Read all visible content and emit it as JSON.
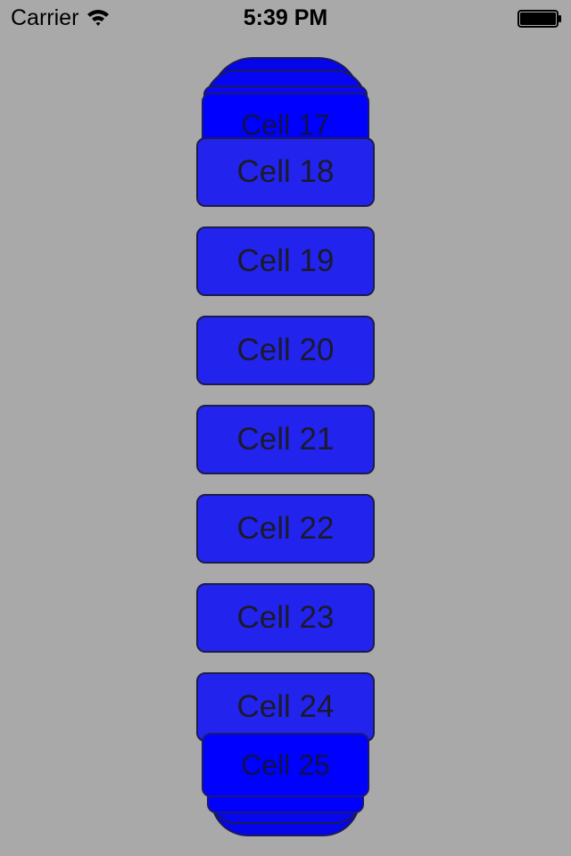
{
  "status_bar": {
    "carrier": "Carrier",
    "time": "5:39 PM",
    "wifi_icon": "wifi-icon",
    "battery_icon": "battery-icon"
  },
  "cells": [
    {
      "label": "Cell 17"
    },
    {
      "label": "Cell 18"
    },
    {
      "label": "Cell 19"
    },
    {
      "label": "Cell 20"
    },
    {
      "label": "Cell 21"
    },
    {
      "label": "Cell 22"
    },
    {
      "label": "Cell 23"
    },
    {
      "label": "Cell 24"
    },
    {
      "label": "Cell 25"
    }
  ],
  "colors": {
    "background": "#a9a9a9",
    "cell_fill": "#2323ee",
    "stacked_cell_fill": "#0000ff",
    "cell_border": "#1c1c4a"
  }
}
